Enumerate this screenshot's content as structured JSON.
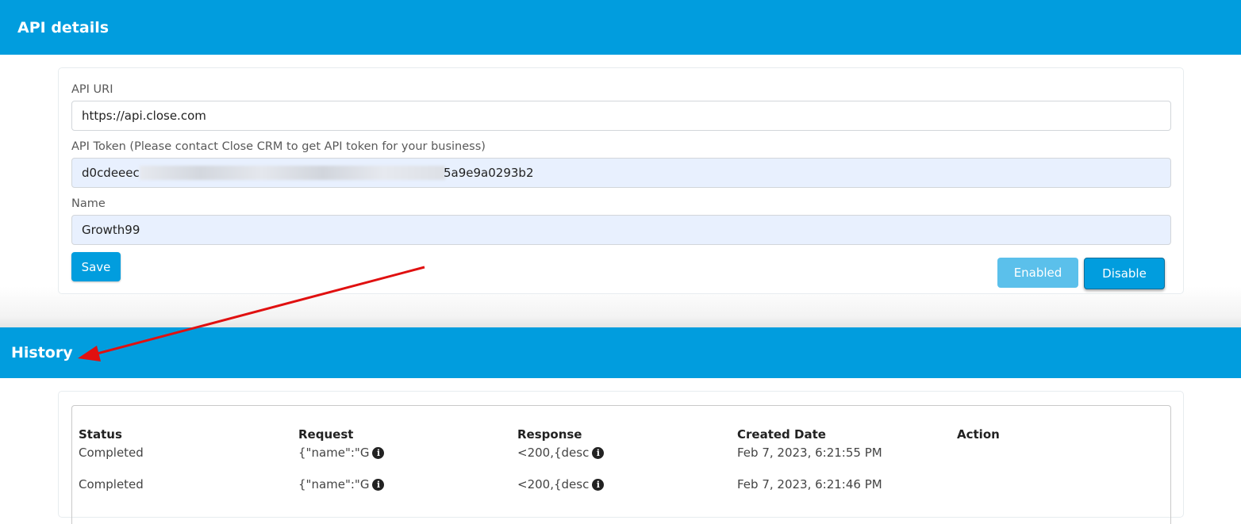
{
  "api_section": {
    "title": "API details",
    "uri_label": "API URI",
    "uri_value": "https://api.close.com",
    "token_label": "API Token (Please contact Close CRM to get API token for your business)",
    "token_prefix": "d0cdeeec",
    "token_suffix": "5a9e9a0293b2",
    "name_label": "Name",
    "name_value": "Growth99",
    "save_label": "Save",
    "enabled_label": "Enabled",
    "disable_label": "Disable"
  },
  "history_section": {
    "title": "History",
    "columns": [
      "Status",
      "Request",
      "Response",
      "Created Date",
      "Action"
    ],
    "rows": [
      {
        "status": "Completed",
        "request": "{\"name\":\"G",
        "response": "<200,{desc",
        "created": "Feb 7, 2023, 6:21:55 PM",
        "action": ""
      },
      {
        "status": "Completed",
        "request": "{\"name\":\"G",
        "response": "<200,{desc",
        "created": "Feb 7, 2023, 6:21:46 PM",
        "action": ""
      }
    ]
  },
  "colors": {
    "header": "#019dde",
    "enabled_button": "#5bc0eb",
    "annotation_arrow": "#e01010"
  },
  "icons": {
    "info": "info-circle-icon",
    "annotation": "red-arrow-annotation"
  }
}
